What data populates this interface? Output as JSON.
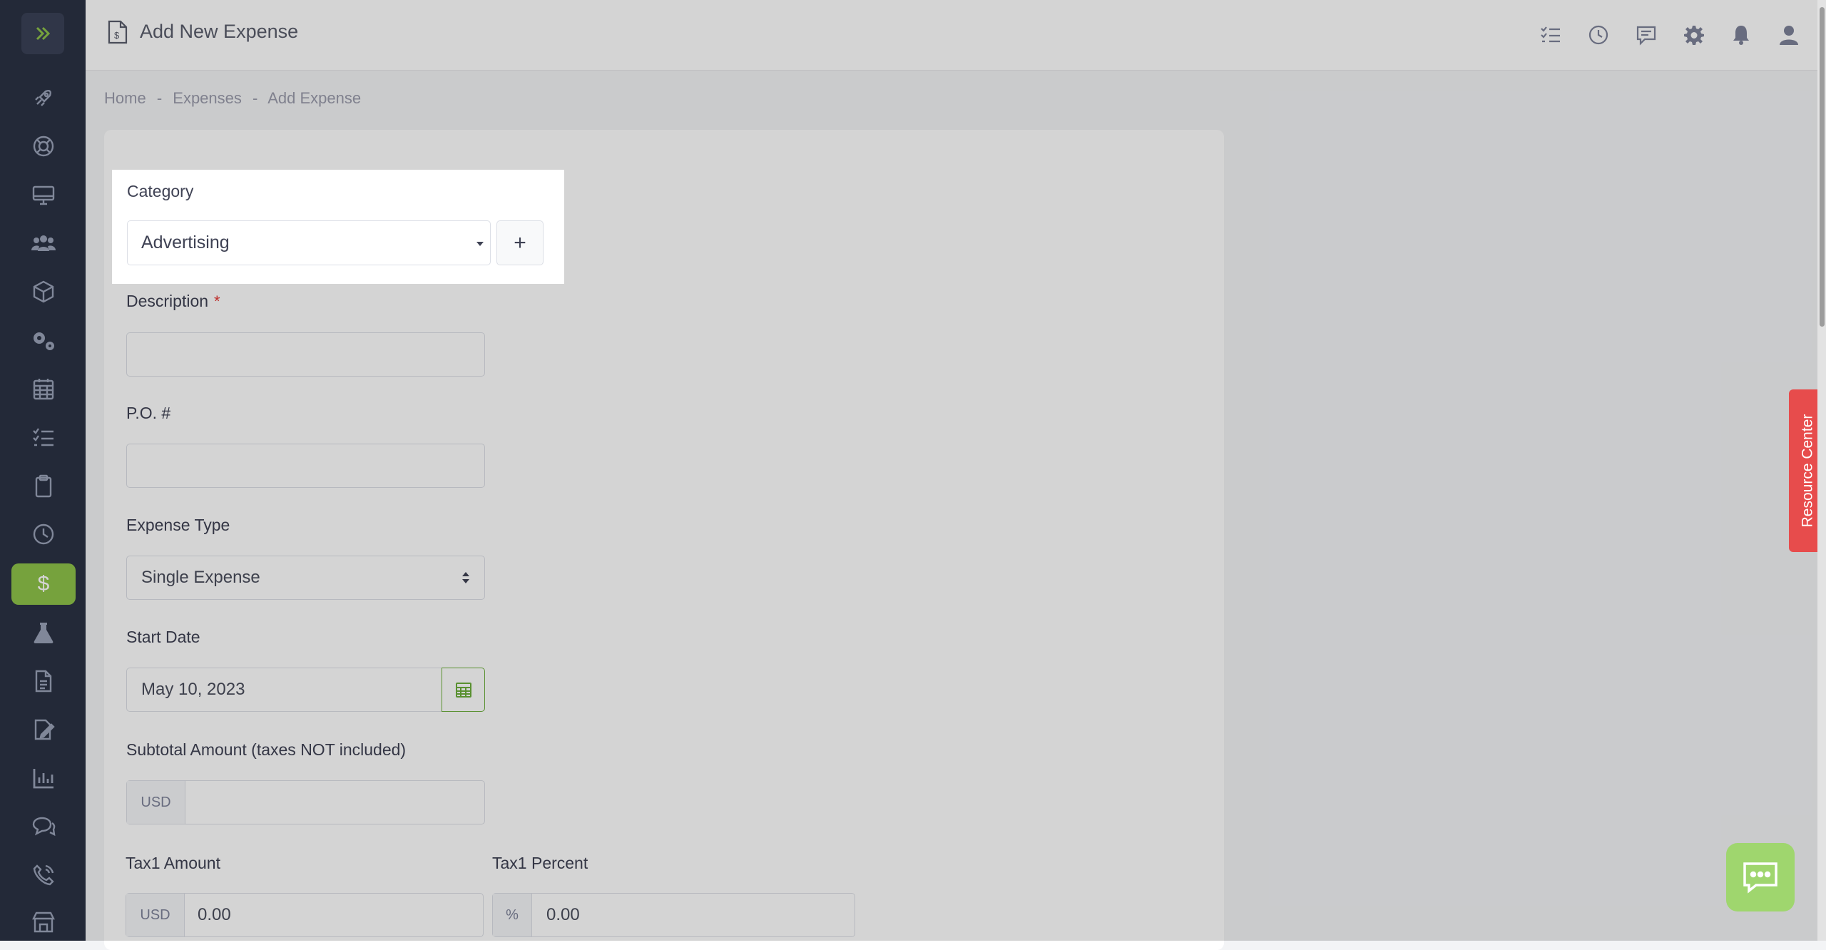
{
  "header": {
    "title": "Add New Expense",
    "icons": [
      "checklist-icon",
      "clock-icon",
      "comment-icon",
      "gear-icon",
      "bell-icon",
      "user-icon"
    ]
  },
  "sidebar": {
    "items": [
      {
        "icon": "rocket-icon"
      },
      {
        "icon": "lifebuoy-icon"
      },
      {
        "icon": "desktop-icon"
      },
      {
        "icon": "users-icon"
      },
      {
        "icon": "box-icon"
      },
      {
        "icon": "gears-icon"
      },
      {
        "icon": "calendar-icon"
      },
      {
        "icon": "tasks-icon"
      },
      {
        "icon": "clipboard-icon"
      },
      {
        "icon": "clock-icon"
      },
      {
        "icon": "dollar-icon",
        "active": true,
        "glyph": "$"
      },
      {
        "icon": "flask-icon"
      },
      {
        "icon": "document-icon"
      },
      {
        "icon": "signature-icon"
      },
      {
        "icon": "chart-icon"
      },
      {
        "icon": "chat-icon"
      },
      {
        "icon": "phone-icon"
      },
      {
        "icon": "store-icon"
      }
    ]
  },
  "breadcrumb": [
    "Home",
    "-",
    "Expenses",
    "-",
    "Add Expense"
  ],
  "form": {
    "category": {
      "label": "Category",
      "value": "Advertising",
      "add_label": "+"
    },
    "description": {
      "label": "Description",
      "required_mark": "*",
      "value": ""
    },
    "po": {
      "label": "P.O. #",
      "value": ""
    },
    "expense_type": {
      "label": "Expense Type",
      "value": "Single Expense"
    },
    "start_date": {
      "label": "Start Date",
      "value": "May 10, 2023"
    },
    "subtotal": {
      "label": "Subtotal Amount (taxes NOT included)",
      "currency": "USD",
      "value": ""
    },
    "tax1_amount": {
      "label": "Tax1 Amount",
      "currency": "USD",
      "value": "0.00"
    },
    "tax1_percent": {
      "label": "Tax1 Percent",
      "unit": "%",
      "value": "0.00"
    }
  },
  "resource_center": {
    "label": "Resource Center"
  },
  "colors": {
    "sidebar": "#2b3244",
    "active": "#8fc34a",
    "resource": "#e74c4c",
    "chat": "#9fd66e",
    "required": "#e53935"
  }
}
